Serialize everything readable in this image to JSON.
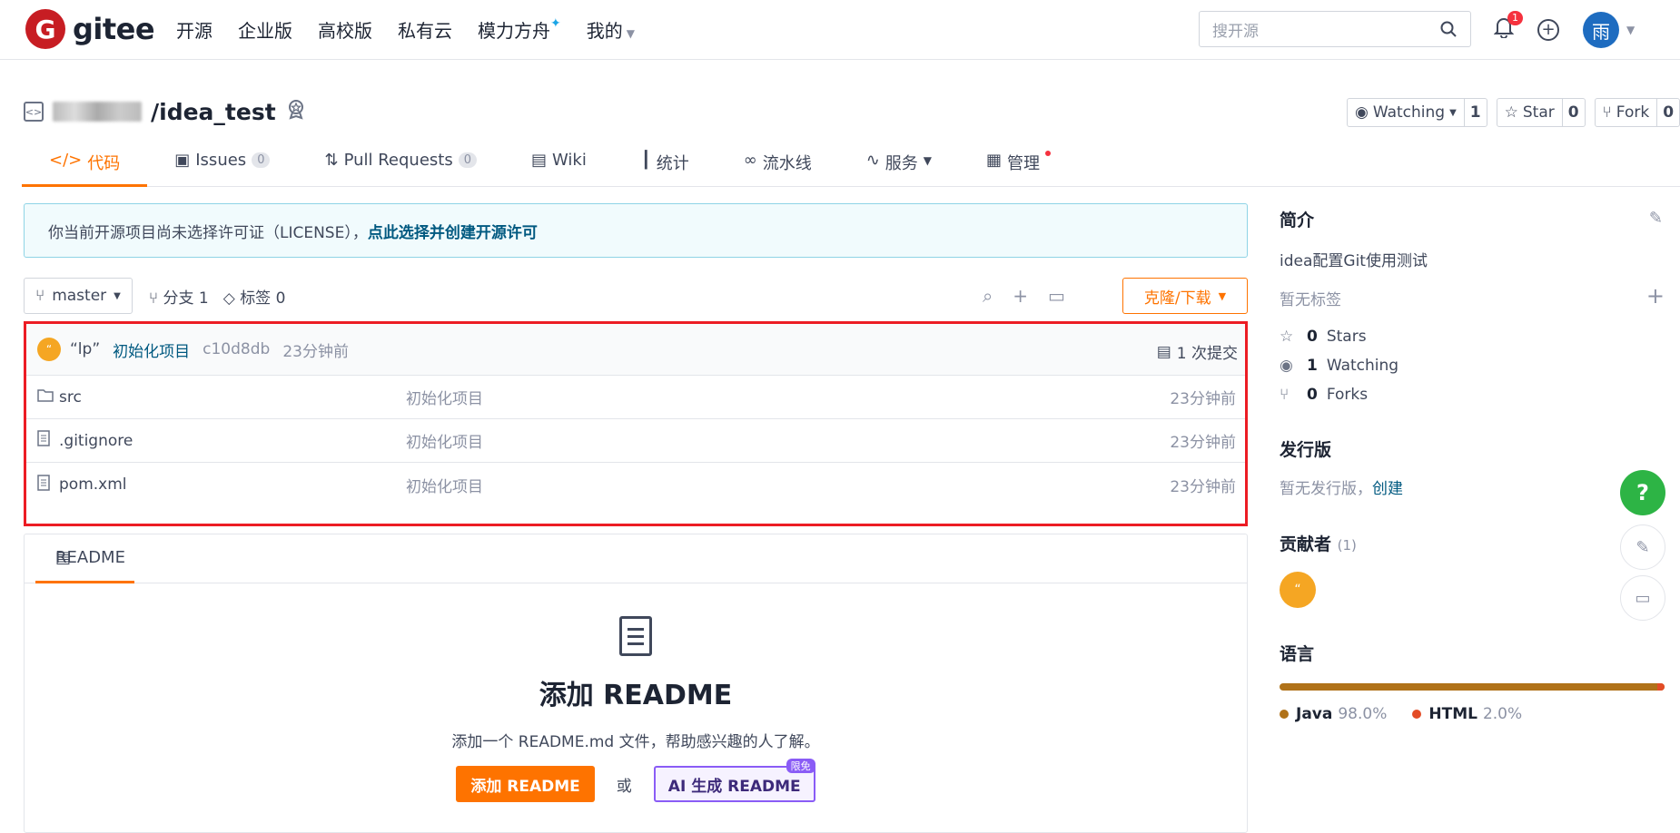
{
  "topbar": {
    "logo_mark": "G",
    "logo_text": "gitee",
    "nav": [
      "开源",
      "企业版",
      "高校版",
      "私有云",
      "模力方舟",
      "我的"
    ],
    "search_placeholder": "搜开源",
    "notification_count": "1",
    "user_avatar_char": "雨"
  },
  "repo": {
    "name": "/idea_test",
    "watching_label": "Watching",
    "watching_count": "1",
    "star_label": "Star",
    "star_count": "0",
    "fork_label": "Fork",
    "fork_count": "0"
  },
  "tabs": [
    {
      "label": "代码",
      "count": ""
    },
    {
      "label": "Issues",
      "count": "0"
    },
    {
      "label": "Pull Requests",
      "count": "0"
    },
    {
      "label": "Wiki",
      "count": ""
    },
    {
      "label": "统计",
      "count": ""
    },
    {
      "label": "流水线",
      "count": ""
    },
    {
      "label": "服务",
      "count": ""
    },
    {
      "label": "管理",
      "count": ""
    }
  ],
  "license_notice": {
    "text": "你当前开源项目尚未选择许可证（LICENSE），",
    "link": "点此选择并创建开源许可"
  },
  "branch": {
    "name": "master",
    "branches_label": "分支 1",
    "tags_label": "标签 0",
    "clone_label": "克隆/下载"
  },
  "commit": {
    "avatar_char": "“",
    "author": "“lp”",
    "message": "初始化项目",
    "sha": "c10d8db",
    "time": "23分钟前",
    "count_label": "1 次提交"
  },
  "files": [
    {
      "name": "src",
      "type": "folder",
      "message": "初始化项目",
      "time": "23分钟前"
    },
    {
      "name": ".gitignore",
      "type": "file",
      "message": "初始化项目",
      "time": "23分钟前"
    },
    {
      "name": "pom.xml",
      "type": "file",
      "message": "初始化项目",
      "time": "23分钟前"
    }
  ],
  "readme": {
    "tab_label": "README",
    "title": "添加 README",
    "description": "添加一个 README.md 文件，帮助感兴趣的人了解。",
    "add_button": "添加 README",
    "or_label": "或",
    "ai_button": "AI 生成 README",
    "ai_badge": "限免"
  },
  "sidebar": {
    "intro_title": "简介",
    "description": "idea配置Git使用测试",
    "no_tags": "暂无标签",
    "stars_count": "0",
    "stars_label": "Stars",
    "watching_count": "1",
    "watching_label": "Watching",
    "forks_count": "0",
    "forks_label": "Forks",
    "release_title": "发行版",
    "release_text": "暂无发行版，",
    "release_link": "创建",
    "contributors_title": "贡献者",
    "contributors_count": "(1)",
    "contributor_avatar_char": "“",
    "language_title": "语言",
    "languages": [
      {
        "name": "Java",
        "percent": "98.0%",
        "color": "#b07219",
        "fraction": 0.98
      },
      {
        "name": "HTML",
        "percent": "2.0%",
        "color": "#e34c26",
        "fraction": 0.02
      }
    ]
  },
  "colors": {
    "accent": "#fe7300",
    "link": "#005980",
    "highlight_border": "#ec1c24"
  }
}
